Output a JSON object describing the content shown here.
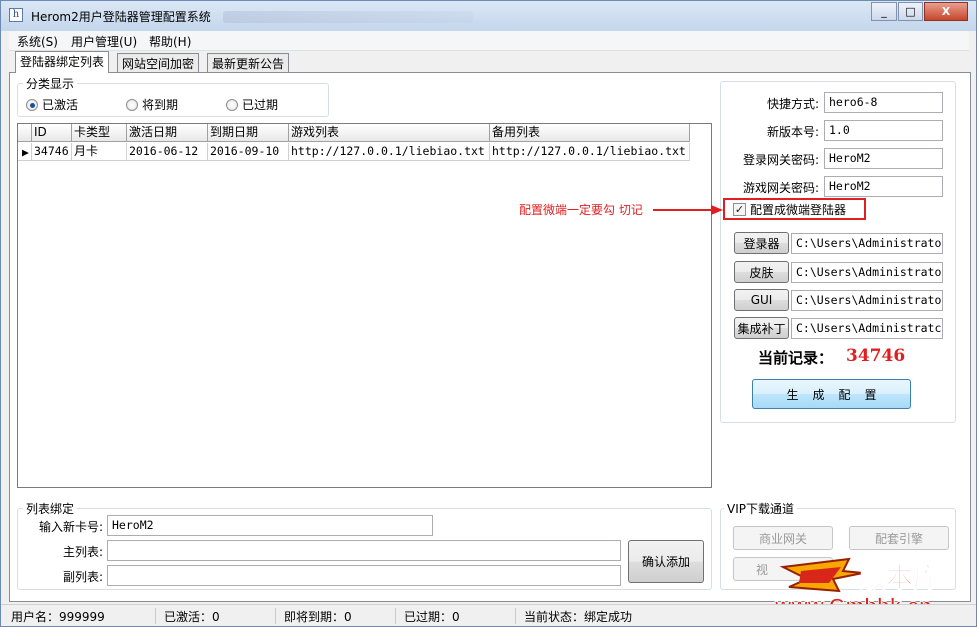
{
  "window": {
    "title": "Herom2用户登陆器管理配置系统",
    "minimize": "_",
    "maximize": "□",
    "close": "X"
  },
  "menu": [
    "系统(S)",
    "用户管理(U)",
    "帮助(H)"
  ],
  "tabs": [
    "登陆器绑定列表",
    "网站空间加密",
    "最新更新公告"
  ],
  "filter": {
    "legend": "分类显示",
    "options": [
      {
        "label": "已激活",
        "checked": true
      },
      {
        "label": "将到期",
        "checked": false
      },
      {
        "label": "已过期",
        "checked": false
      }
    ]
  },
  "grid": {
    "columns": [
      "ID",
      "卡类型",
      "激活日期",
      "到期日期",
      "游戏列表",
      "备用列表"
    ],
    "rows": [
      [
        "34746",
        "月卡",
        "2016-06-12",
        "2016-09-10",
        "http://127.0.0.1/liebiao.txt",
        "http://127.0.0.1/liebiao.txt"
      ]
    ]
  },
  "settings": {
    "fields": [
      {
        "label": "快捷方式:",
        "value": "hero6-8"
      },
      {
        "label": "新版本号:",
        "value": "1.0"
      },
      {
        "label": "登录网关密码:",
        "value": "HeroM2"
      },
      {
        "label": "游戏网关密码:",
        "value": "HeroM2"
      }
    ],
    "checkbox_label": "配置成微端登陆器",
    "checkbox_checked": true,
    "path_buttons": [
      {
        "label": "登录器",
        "value": "C:\\Users\\Administrato"
      },
      {
        "label": "皮肤",
        "value": "C:\\Users\\Administrato"
      },
      {
        "label": "GUI",
        "value": "C:\\Users\\Administrato"
      },
      {
        "label": "集成补丁",
        "value": "C:\\Users\\Administratc"
      }
    ],
    "record_label": "当前记录：",
    "record_value": "34746",
    "generate_button": "生成配置"
  },
  "annotation": "配置微端一定要勾 切记",
  "binding": {
    "legend": "列表绑定",
    "new_card_label": "输入新卡号:",
    "new_card_value": "HeroM2",
    "main_list_label": "主列表:",
    "main_list_value": "",
    "sub_list_label": "副列表:",
    "sub_list_value": "",
    "confirm_button": "确认添加"
  },
  "vip": {
    "legend": "VIP下载通道",
    "buttons": [
      "商业网关",
      "配套引擎",
      "视"
    ]
  },
  "status": {
    "user": "用户名：999999",
    "activated": "已激活：0",
    "expiring": "即将到期：0",
    "expired": "已过期：0",
    "state": "当前状态：绑定成功"
  },
  "watermark": {
    "brand": "版本库",
    "url": "www.Gmbbk.cn"
  },
  "colors": {
    "annotation": "#e02020",
    "record_value": "#e02020",
    "title_bar": "#c4d6ec"
  }
}
